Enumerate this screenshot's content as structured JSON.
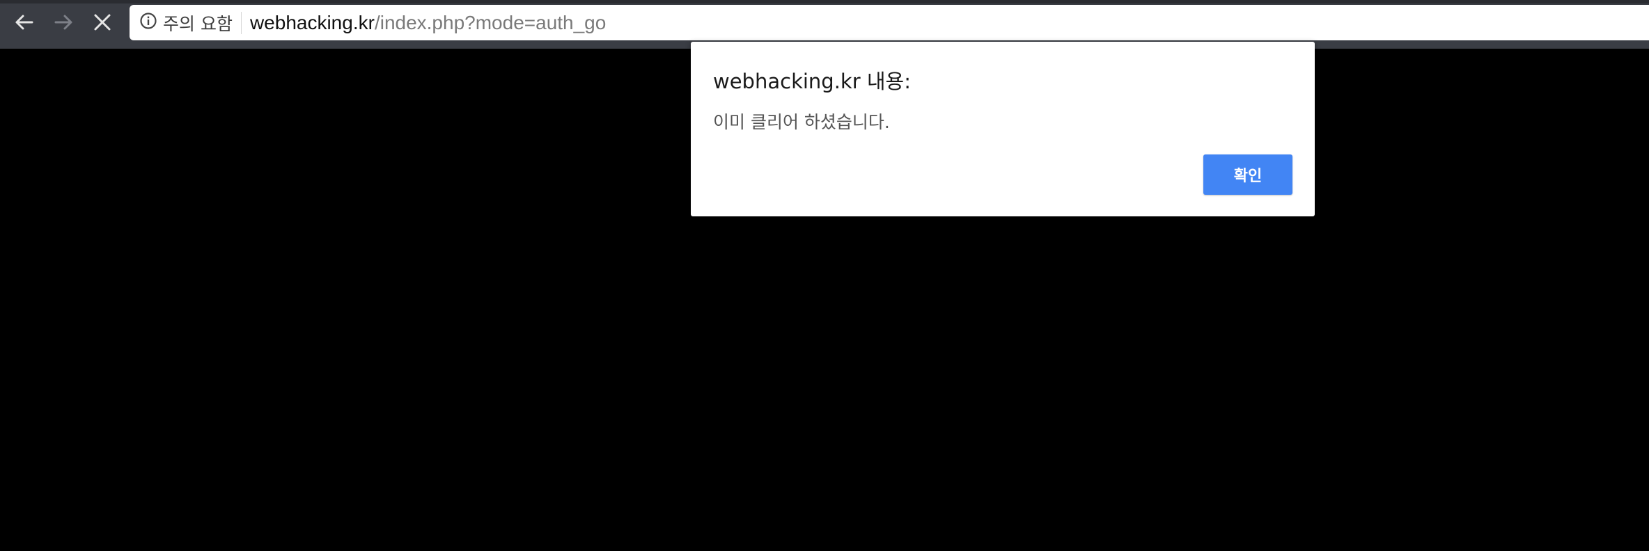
{
  "browser": {
    "nav": {
      "back_icon": "arrow-left-icon",
      "forward_icon": "arrow-right-icon",
      "stop_icon": "close-icon"
    },
    "omnibox": {
      "security_icon": "info-circle-icon",
      "security_label": "주의 요함",
      "url_host": "webhacking.kr",
      "url_path": "/index.php?mode=auth_go"
    }
  },
  "alert": {
    "title": "webhacking.kr 내용:",
    "message": "이미 클리어 하셨습니다.",
    "ok_label": "확인"
  },
  "colors": {
    "toolbar": "#3a3d44",
    "page_background": "#000000",
    "ok_button": "#4285f4"
  }
}
